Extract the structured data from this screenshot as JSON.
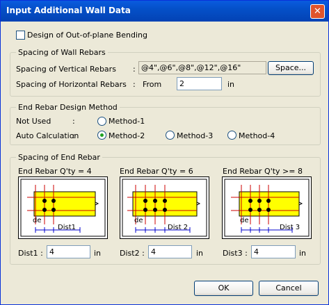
{
  "window": {
    "title": "Input Additional Wall Data",
    "close_glyph": "✕"
  },
  "out_of_plane": {
    "label": "Design of Out-of-plane Bending",
    "checked": false
  },
  "wall_rebars": {
    "legend": "Spacing of Wall Rebars",
    "vertical_label": "Spacing of Vertical Rebars",
    "vertical_colon": ":",
    "vertical_value": "@4\",@6\",@8\",@12\",@16\"",
    "space_button": "Space...",
    "horizontal_label": "Spacing of Horizontal Rebars",
    "horizontal_colon": ":",
    "from_label": "From",
    "from_value": "2",
    "unit": "in"
  },
  "end_rebar_method": {
    "legend": "End Rebar Design Method",
    "not_used_label": "Not Used",
    "not_used_colon": ":",
    "auto_label": "Auto Calculation",
    "auto_colon": ":",
    "options": [
      {
        "label": "Method-1",
        "selected": false
      },
      {
        "label": "Method-2",
        "selected": true
      },
      {
        "label": "Method-3",
        "selected": false
      },
      {
        "label": "Method-4",
        "selected": false
      }
    ]
  },
  "end_rebar_spacing": {
    "legend": "Spacing of End Rebar",
    "panels": [
      {
        "heading": "End Rebar Q'ty = 4",
        "dist_label": "Dist1",
        "de_label": "de",
        "input_label": "Dist1 :",
        "value": "4",
        "unit": "in"
      },
      {
        "heading": "End Rebar Q'ty = 6",
        "dist_label": "Dist 2",
        "de_label": "de",
        "input_label": "Dist2 :",
        "value": "4",
        "unit": "in"
      },
      {
        "heading": "End Rebar Q'ty >= 8",
        "dist_label": "Dist 3",
        "de_label": "de",
        "input_label": "Dist3 :",
        "value": "4",
        "unit": "in"
      }
    ]
  },
  "buttons": {
    "ok": "OK",
    "cancel": "Cancel"
  },
  "colors": {
    "wall_fill": "#ffff00",
    "rebar": "#cc0000",
    "dot": "#000000",
    "dim": "#0000cc"
  }
}
